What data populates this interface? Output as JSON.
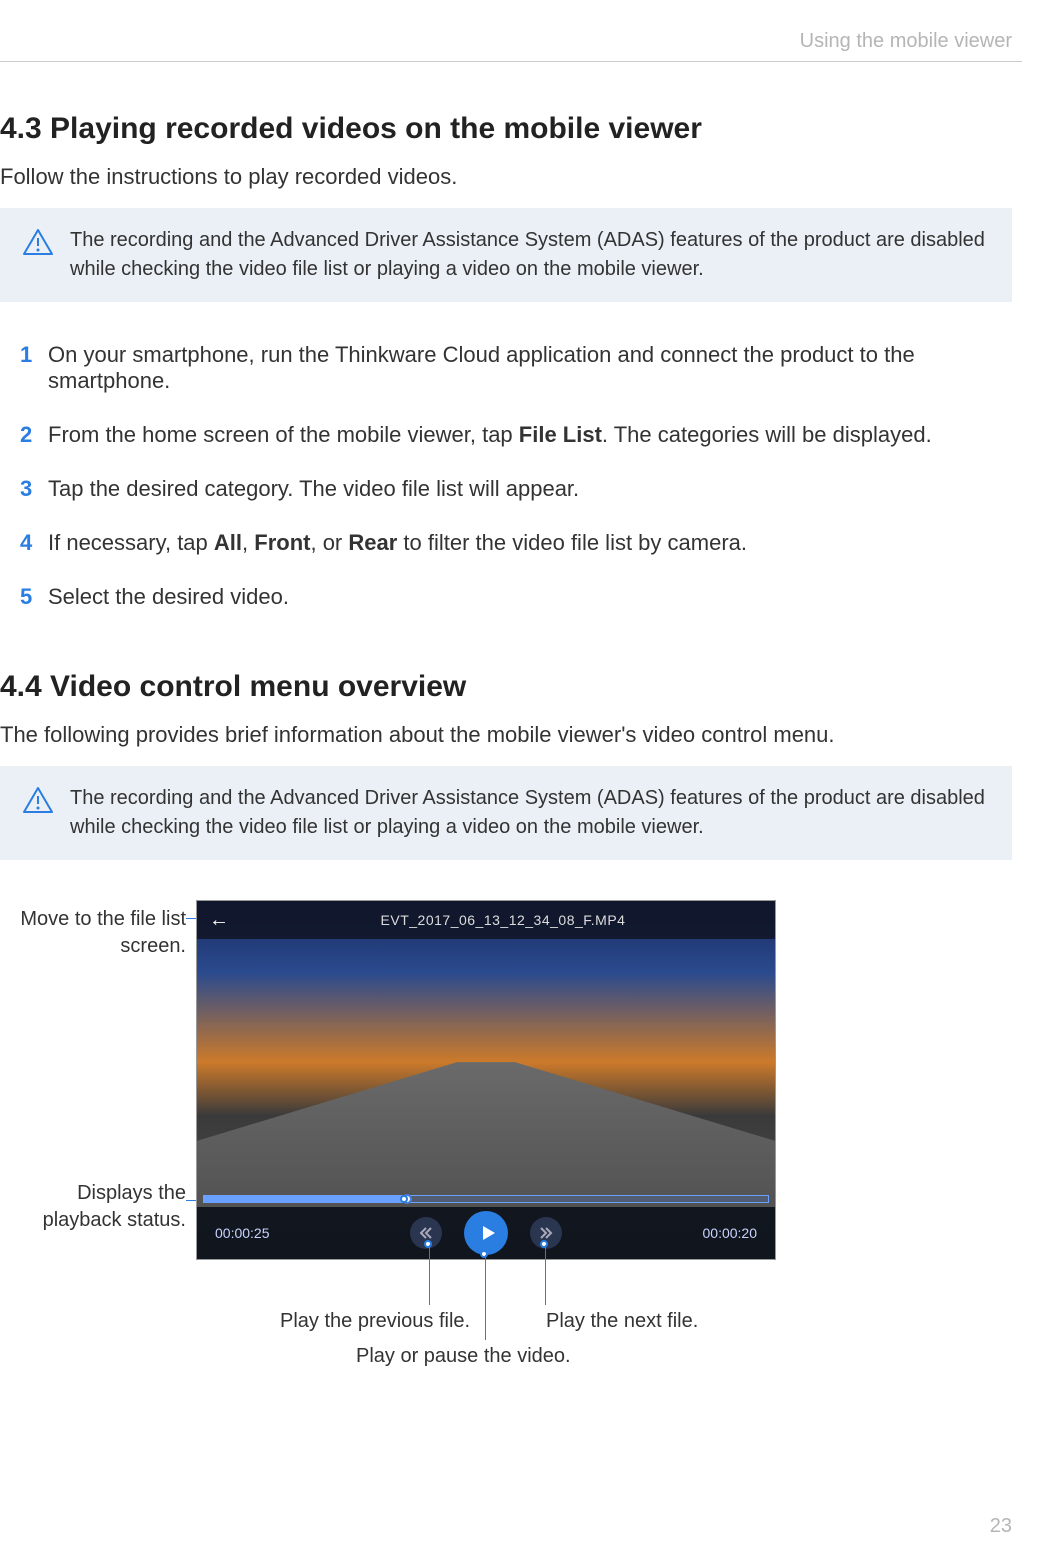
{
  "header": {
    "chapter": "Using the mobile viewer"
  },
  "section43": {
    "title": "4.3   Playing recorded videos on the mobile viewer",
    "intro": "Follow the instructions to play recorded videos.",
    "info": "The recording and the Advanced Driver Assistance System (ADAS) features of the product are disabled while checking the video file list or playing a video on the mobile viewer.",
    "steps": [
      {
        "n": "1",
        "pre": "On your smartphone, run the Thinkware Cloud application and connect the product to the smartphone."
      },
      {
        "n": "2",
        "pre": "From the home screen of the mobile viewer, tap ",
        "b": "File List",
        "post": ". The categories will be displayed."
      },
      {
        "n": "3",
        "pre": "Tap the desired category. The video file list will appear."
      },
      {
        "n": "4",
        "pre": "If necessary, tap ",
        "b": "All",
        "mid1": ", ",
        "b2": "Front",
        "mid2": ", or ",
        "b3": "Rear",
        "post": " to filter the video file list by camera."
      },
      {
        "n": "5",
        "pre": "Select the desired video."
      }
    ]
  },
  "section44": {
    "title": "4.4   Video control menu overview",
    "intro": "The following provides brief information about the mobile viewer's video control menu.",
    "info": "The recording and the Advanced Driver Assistance System (ADAS) features of the product are disabled while checking the video file list or playing a video on the mobile viewer."
  },
  "player": {
    "filename": "EVT_2017_06_13_12_34_08_F.MP4",
    "elapsed": "00:00:25",
    "remaining": "00:00:20"
  },
  "callouts": {
    "back": "Move to the file list screen.",
    "progress": "Displays the playback status.",
    "prev": "Play the previous file.",
    "next": "Play the next file.",
    "playpause": "Play or pause the video."
  },
  "page": "23"
}
